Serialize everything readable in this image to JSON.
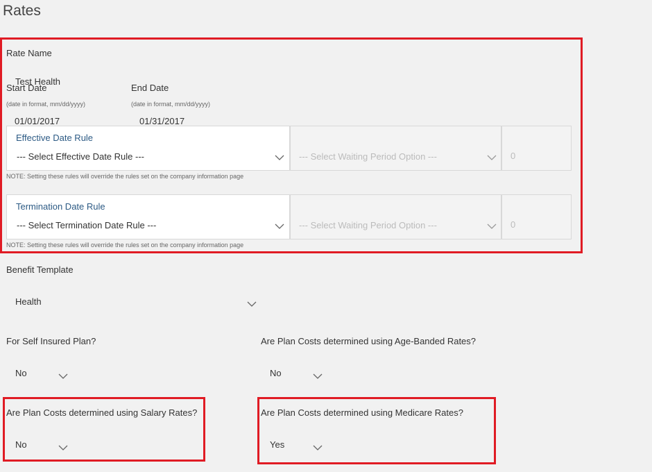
{
  "page": {
    "title": "Rates"
  },
  "rate_name": {
    "label": "Rate Name",
    "value": "Test Health"
  },
  "start_date": {
    "label": "Start Date",
    "hint": "(date in format, mm/dd/yyyy)",
    "value": "01/01/2017"
  },
  "end_date": {
    "label": "End Date",
    "hint": "(date in format, mm/dd/yyyy)",
    "value": "01/31/2017"
  },
  "effective_rule": {
    "title": "Effective Date Rule",
    "select_value": "--- Select Effective Date Rule ---",
    "waiting_placeholder": "--- Select Waiting Period Option ---",
    "number_value": "0",
    "note": "NOTE: Setting these rules will override the rules set on the company information page"
  },
  "termination_rule": {
    "title": "Termination Date Rule",
    "select_value": "--- Select Termination Date Rule ---",
    "waiting_placeholder": "--- Select Waiting Period Option ---",
    "number_value": "0",
    "note": "NOTE: Setting these rules will override the rules set on the company information page"
  },
  "benefit_template": {
    "label": "Benefit Template",
    "value": "Health"
  },
  "self_insured": {
    "label": "For Self Insured Plan?",
    "value": "No"
  },
  "age_banded": {
    "label": "Are Plan Costs determined using Age-Banded Rates?",
    "value": "No"
  },
  "salary_rates": {
    "label": "Are Plan Costs determined using Salary Rates?",
    "value": "No"
  },
  "medicare_rates": {
    "label": "Are Plan Costs determined using Medicare Rates?",
    "value": "Yes"
  },
  "colors": {
    "highlight": "#e01b24",
    "link_blue": "#2c5a84",
    "background": "#f1f1f1"
  },
  "icons": {
    "dropdown": "chevron-down-icon"
  }
}
